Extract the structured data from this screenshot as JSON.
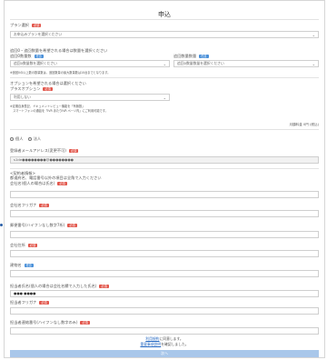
{
  "page": {
    "title": "申込"
  },
  "plan": {
    "label": "プラン選択",
    "required": "必須",
    "placeholder": "お申込みプランを選択ください"
  },
  "router": {
    "intro": "追回0・追回数量を希望される場合は数量を選択ください",
    "qty_label": "追回0数量数",
    "optional": "任意",
    "qty_placeholder": "追回0数量数を選択ください",
    "count_label": "追回数量数量",
    "count_placeholder": "追回0数量数量を選択ください",
    "note": "※追回0の以上数の数量数は、追回数量の最大数量数は10台までとなります。"
  },
  "option": {
    "intro": "オプションを希望される場合は選択ください",
    "label": "プラスオプション",
    "required": "必須",
    "value": "利用しない",
    "note1": "※定期自身表記、ドキュメントレビュー機能を「有無数」",
    "note2": "　スマートフォンの通話を「IVR あたりIVR ページ内」にご利用可能です。"
  },
  "price_text": "月額料金 0円 (税込)",
  "applicant_type": {
    "options": [
      "個人",
      "法人"
    ]
  },
  "email": {
    "label": "登録者メールアドレス(変更不可)",
    "required": "必須",
    "value": "s1de●●●●●●●●@●●●●●●●●"
  },
  "contract": {
    "heading": "<契約者情報>",
    "subnote": "都道府名、電話番号以外の項目は全角で入力ください",
    "name_label": "会社名(個人の場合は氏名)",
    "kana_label": "会社名フリガナ",
    "zip_label": "郵便番号(ハイフンなし数字7桁)",
    "address_label": "会社住所",
    "building_label": "建物名",
    "contact_name_label": "担当者氏名(個人の場合は会社名欄で入力した氏名)",
    "contact_name_value": "●●● ●●●●",
    "contact_kana_label": "担当者フリガナ",
    "phone_label": "担当者連絡番号(ハイフンなし数字のみ)",
    "required": "必須",
    "optional": "任意"
  },
  "agreement": {
    "terms_link": "利用規約",
    "terms_text": "に同意します。",
    "notice_link": "重要事項説明",
    "notice_text": "を確認しました。"
  },
  "next_button": "次へ"
}
